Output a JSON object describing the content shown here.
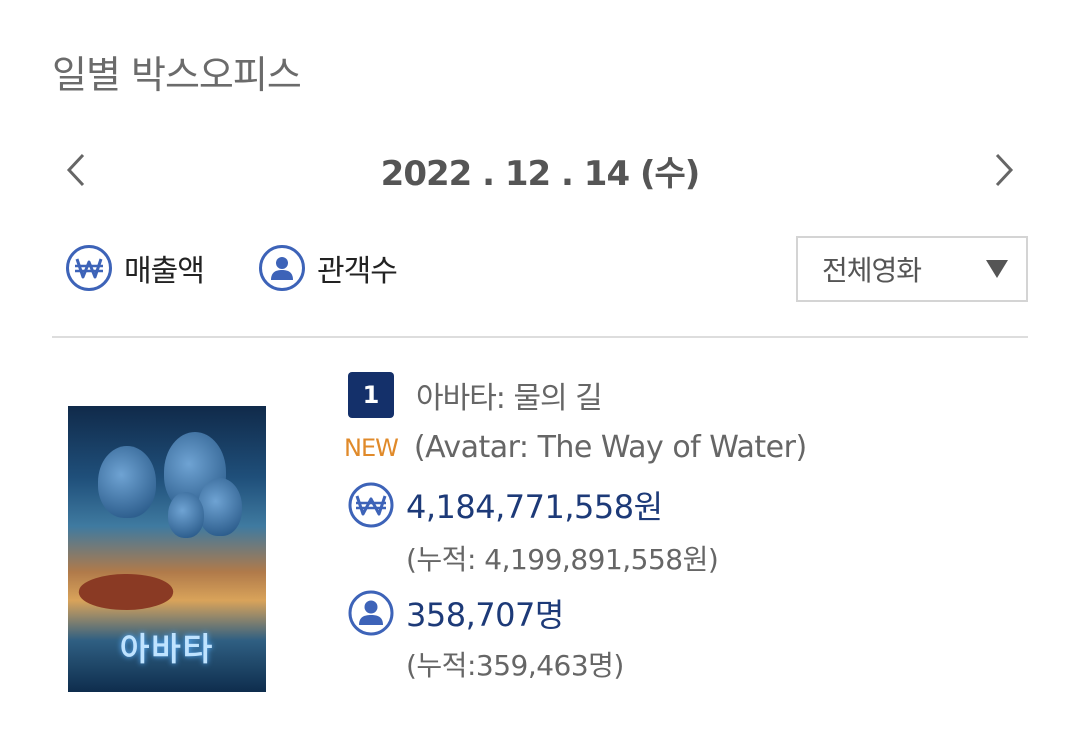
{
  "section_title": "일별 박스오피스",
  "date_nav": {
    "date": "2022 . 12 . 14 (수)",
    "prev_icon": "chevron-left-icon",
    "next_icon": "chevron-right-icon"
  },
  "toolbar": {
    "sales_label": "매출액",
    "audience_label": "관객수",
    "filter_value": "전체영화"
  },
  "movie": {
    "rank": "1",
    "title_ko": "아바타: 물의 길",
    "badge": "NEW",
    "title_en": "(Avatar: The Way of Water)",
    "sales": "4,184,771,558원",
    "sales_cumulative": "(누적: 4,199,891,558원)",
    "audience": "358,707명",
    "audience_cumulative": "(누적:359,463명)",
    "poster_title": "아바타"
  },
  "colors": {
    "accent": "#3d63b8",
    "rank_badge": "#14306a",
    "value_text": "#1d3a78",
    "new_badge": "#e08a2a"
  }
}
